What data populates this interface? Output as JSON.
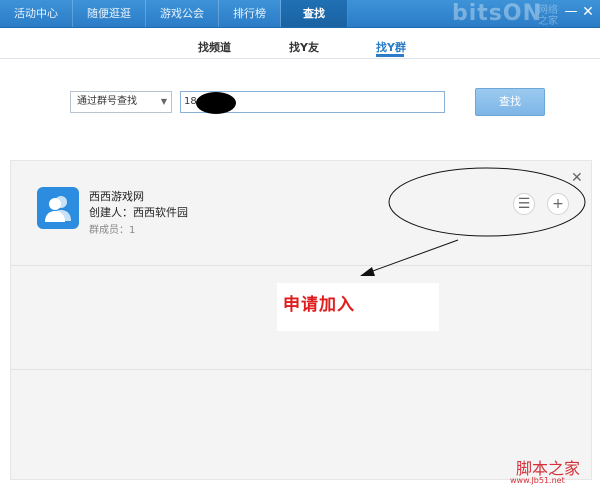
{
  "topnav": {
    "tabs": [
      {
        "label": "活动中心",
        "active": false
      },
      {
        "label": "随便逛逛",
        "active": false
      },
      {
        "label": "游戏公会",
        "active": false
      },
      {
        "label": "排行榜",
        "active": false
      },
      {
        "label": "查找",
        "active": true
      }
    ],
    "brand_watermark": "bitsON",
    "brand_watermark_cn": "网络之家",
    "minimize_glyph": "—",
    "close_glyph": "✕"
  },
  "subtabs": {
    "items": [
      {
        "label": "找频道",
        "active": false
      },
      {
        "label": "找Y友",
        "active": false
      },
      {
        "label": "找Y群",
        "active": true
      }
    ]
  },
  "search": {
    "mode_selected": "通过群号查找",
    "input_value": "18",
    "find_button": "查找"
  },
  "results": [
    {
      "group_name": "西西游戏网",
      "creator": "创建人：西西软件园",
      "members": "群成员：1",
      "list_icon": "list-icon",
      "add_icon": "plus-icon",
      "add_glyph": "+",
      "list_glyph": "☰",
      "close_glyph": "✕"
    }
  ],
  "annotation": {
    "text": "申请加入",
    "color": "#e01c1c"
  },
  "footer": {
    "logo": "脚本之家",
    "url": "www.Jb51.net"
  },
  "colors": {
    "accent": "#2a7cc6",
    "avatar": "#2c8de0"
  }
}
